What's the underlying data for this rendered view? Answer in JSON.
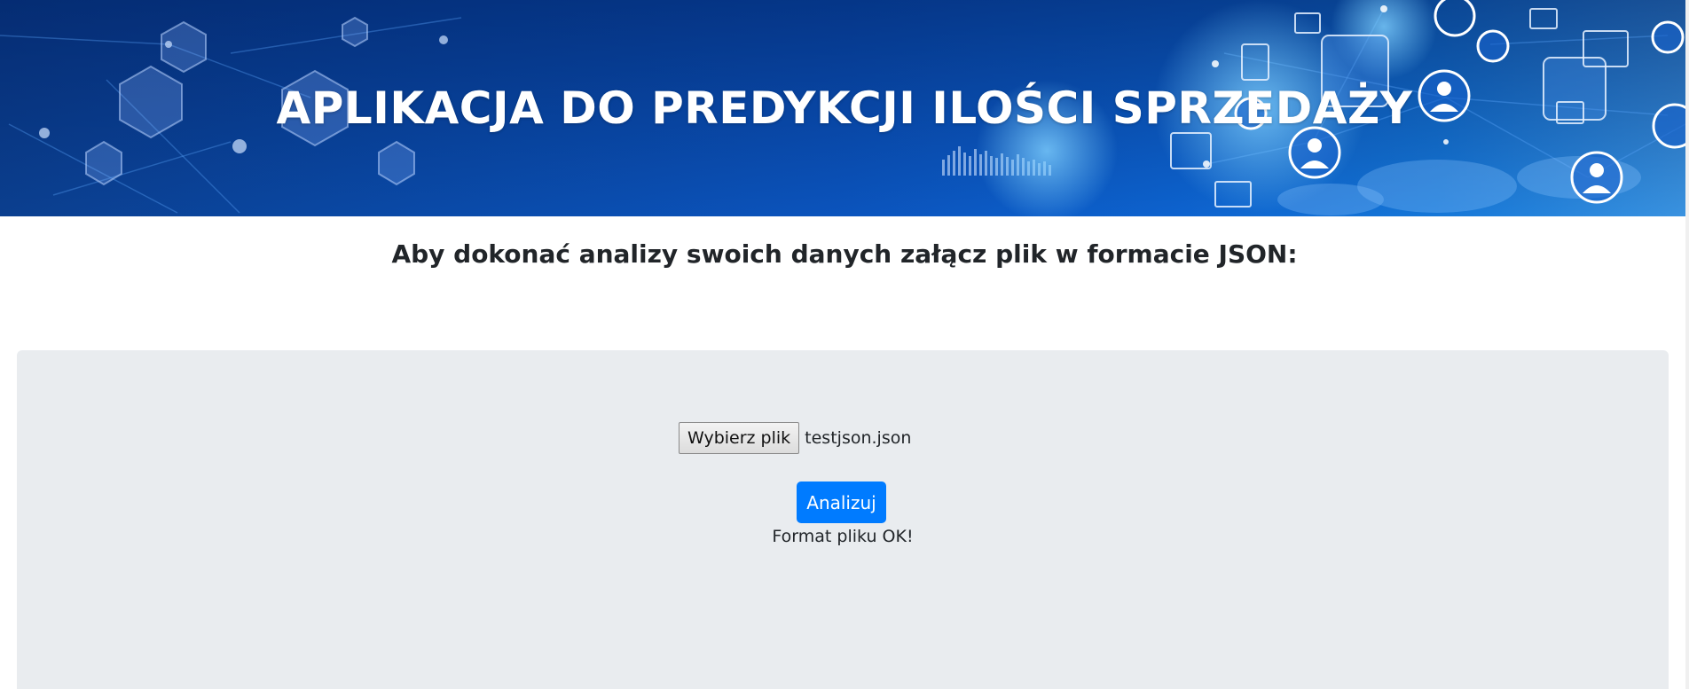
{
  "banner": {
    "title": "APLIKACJA DO PREDYKCJI ILOŚCI SPRZEDAŻY"
  },
  "intro": {
    "text": "Aby dokonać analizy swoich danych załącz plik w formacie JSON:"
  },
  "upload": {
    "choose_file_label": "Wybierz plik",
    "selected_file_name": "testjson.json",
    "analyze_label": "Analizuj",
    "status_message": "Format pliku OK!"
  },
  "colors": {
    "banner_blue": "#0b54bd",
    "panel_gray": "#e9ecef",
    "primary_button": "#007bff"
  }
}
